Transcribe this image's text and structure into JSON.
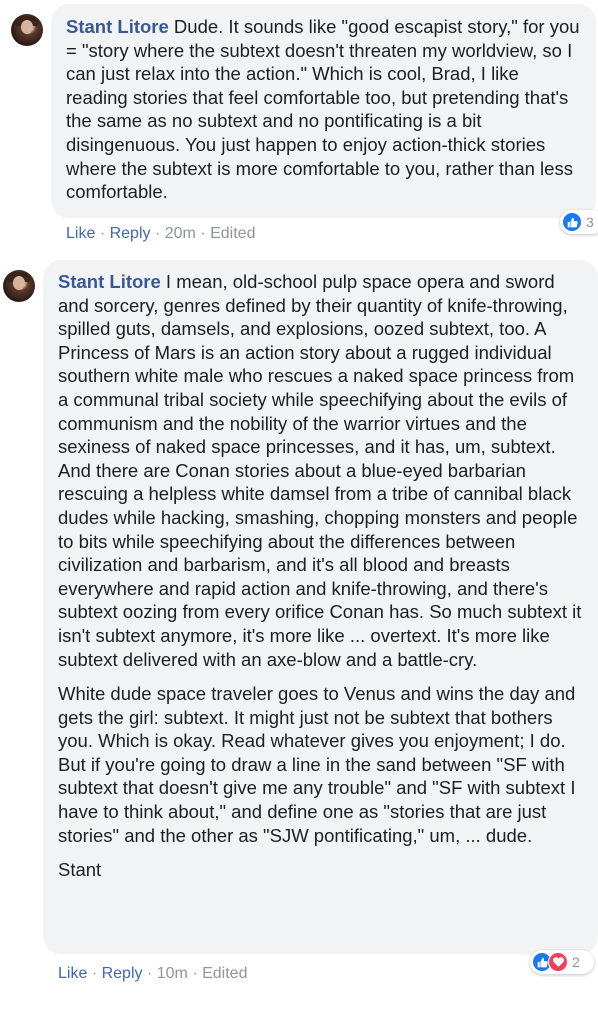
{
  "colors": {
    "bubble": "#f2f3f5",
    "author": "#385898",
    "link": "#4267b2",
    "meta": "#90949c",
    "like": "#1877f2",
    "love": "#f33e58"
  },
  "comments": [
    {
      "author": "Stant Litore",
      "paragraphs": [
        "Dude. It sounds like \"good escapist story,\" for you = \"story where the subtext doesn't threaten my worldview, so I can just relax into the action.\" Which is cool, Brad, I like reading stories that feel comfortable too, but pretending that's the same as no subtext and no pontificating is a bit disingenuous. You just happen to enjoy action-thick stories where the subtext is more comfortable to you, rather than less comfortable."
      ],
      "actions": {
        "like": "Like",
        "reply": "Reply",
        "time": "20m",
        "edited": "Edited"
      },
      "reactions": {
        "icons": [
          "like-icon"
        ],
        "count": "3"
      }
    },
    {
      "author": "Stant Litore",
      "paragraphs": [
        "I mean, old-school pulp space opera and sword and sorcery, genres defined by their quantity of knife-throwing, spilled guts, damsels, and explosions, oozed subtext, too. A Princess of Mars is an action story about a rugged individual southern white male who rescues a naked space princess from a communal tribal society while speechifying about the evils of communism and the nobility of the warrior virtues and the sexiness of naked space princesses, and it has, um, subtext. And there are Conan stories about a blue-eyed barbarian rescuing a helpless white damsel from a tribe of cannibal black dudes while hacking, smashing, chopping monsters and people to bits while speechifying about the differences between civilization and barbarism, and it's all blood and breasts everywhere and rapid action and knife-throwing, and there's subtext oozing from every orifice Conan has. So much subtext it isn't subtext anymore, it's more like ... overtext. It's more like subtext delivered with an axe-blow and a battle-cry.",
        "White dude space traveler goes to Venus and wins the day and gets the girl: subtext. It might just not be subtext that bothers you. Which is okay. Read whatever gives you enjoyment; I do. But if you're going to draw a line in the sand between \"SF with subtext that doesn't give me any trouble\" and \"SF with subtext I have to think about,\" and define one as \"stories that are just stories\" and the other as \"SJW pontificating,\" um, ... dude.",
        "Stant"
      ],
      "actions": {
        "like": "Like",
        "reply": "Reply",
        "time": "10m",
        "edited": "Edited"
      },
      "reactions": {
        "icons": [
          "like-icon",
          "heart-icon"
        ],
        "count": "2"
      }
    }
  ],
  "separator": "·"
}
